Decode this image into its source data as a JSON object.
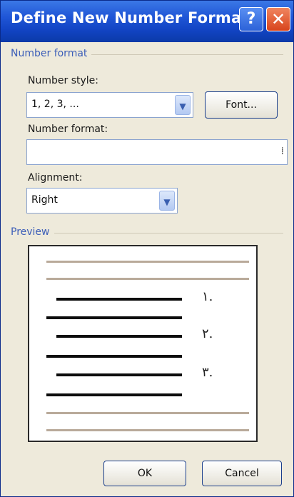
{
  "dialog": {
    "title": "Define New Number Format",
    "help_glyph": "?",
    "close_glyph": "✕"
  },
  "number_format_group": {
    "label": "Number format",
    "number_style": {
      "label": "Number style:",
      "value": "1, 2, 3, ..."
    },
    "font_button": "Font...",
    "number_format": {
      "label": "Number format:",
      "value": ""
    },
    "alignment": {
      "label": "Alignment:",
      "value": "Right"
    }
  },
  "preview_group": {
    "label": "Preview",
    "numbers": [
      "١.",
      "٢.",
      "٣."
    ]
  },
  "buttons": {
    "ok": "OK",
    "cancel": "Cancel"
  },
  "colors": {
    "title_bar": "#1f55d6",
    "group_label": "#3c5eb8",
    "dialog_bg": "#eeeadb"
  }
}
